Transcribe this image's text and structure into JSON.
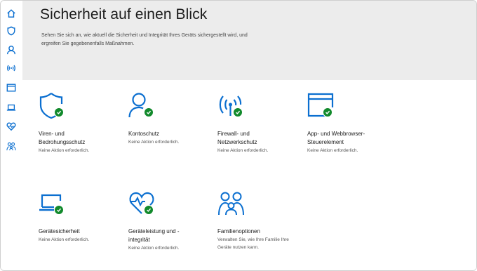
{
  "sidebar": {
    "items": [
      {
        "icon": "home-icon"
      },
      {
        "icon": "shield-icon"
      },
      {
        "icon": "person-icon"
      },
      {
        "icon": "wifi-icon"
      },
      {
        "icon": "browser-window-icon"
      },
      {
        "icon": "laptop-icon"
      },
      {
        "icon": "heart-icon"
      },
      {
        "icon": "family-icon"
      }
    ]
  },
  "header": {
    "title": "Sicherheit auf einen Blick",
    "subtitle": "Sehen Sie sich an, wie aktuell die Sicherheit und Integrität Ihres Geräts sichergestellt wird, und ergreifen Sie gegebenenfalls Maßnahmen."
  },
  "tiles": [
    {
      "icon": "shield-icon",
      "title": "Viren- und Bedrohungsschutz",
      "status": "Keine Aktion erforderlich."
    },
    {
      "icon": "person-icon",
      "title": "Kontoschutz",
      "status": "Keine Aktion erforderlich."
    },
    {
      "icon": "wifi-icon",
      "title": "Firewall- und Netzwerkschutz",
      "status": "Keine Aktion erforderlich."
    },
    {
      "icon": "browser-window-icon",
      "title": "App- und Webbrowser-Steuerelement",
      "status": "Keine Aktion erforderlich."
    },
    {
      "icon": "laptop-icon",
      "title": "Gerätesicherheit",
      "status": "Keine Aktion erforderlich."
    },
    {
      "icon": "heart-icon",
      "title": "Geräteleistung und -integrität",
      "status": "Keine Aktion erforderlich."
    },
    {
      "icon": "family-icon",
      "title": "Familienoptionen",
      "status": "Verwalten Sie, wie Ihre Familie Ihre Geräte nutzen kann."
    }
  ],
  "colors": {
    "accent": "#0b6fd0",
    "ok": "#128a2c",
    "header_bg": "#ececec"
  }
}
